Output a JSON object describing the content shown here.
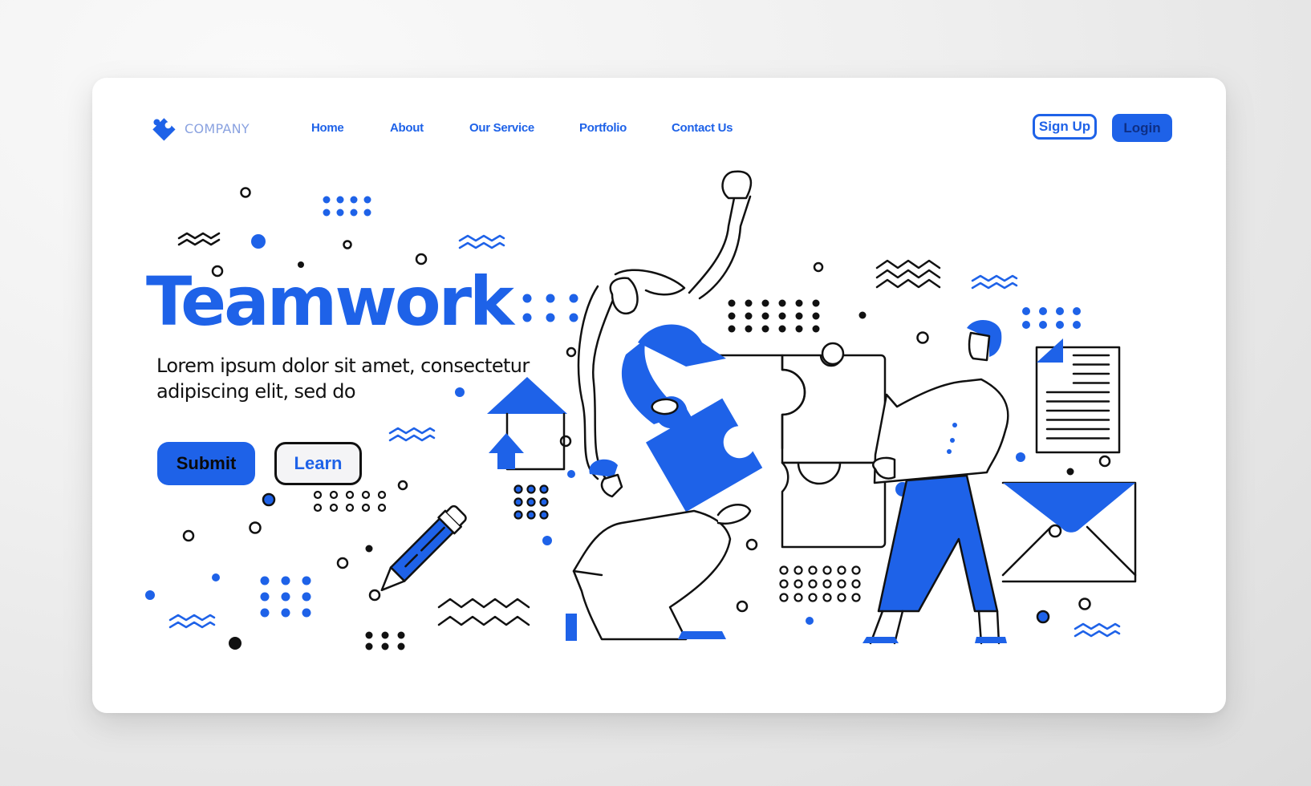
{
  "brand": {
    "name": "COMPANY",
    "logo_icon": "puzzle-piece-icon",
    "accent_color": "#1e62e8",
    "logo_text_color": "#8aa2e0"
  },
  "nav": {
    "links": [
      {
        "label": "Home"
      },
      {
        "label": "About"
      },
      {
        "label": "Our Service"
      },
      {
        "label": "Portfolio"
      },
      {
        "label": "Contact Us"
      }
    ],
    "signup_label": "Sign Up",
    "login_label": "Login"
  },
  "hero": {
    "title": "Teamwork",
    "subtitle": "Lorem ipsum dolor sit amet, consectetur adipiscing elit, sed do",
    "submit_label": "Submit",
    "learn_label": "Learn"
  },
  "illustration": {
    "subject": "team assembling puzzle pieces",
    "elements": [
      "woman-raising-arm",
      "kneeling-man-holding-puzzle-piece",
      "standing-man-holding-puzzle",
      "puzzle-board",
      "document-icon",
      "envelope-icon",
      "pencil-icon",
      "upload-arrow-icon"
    ]
  }
}
